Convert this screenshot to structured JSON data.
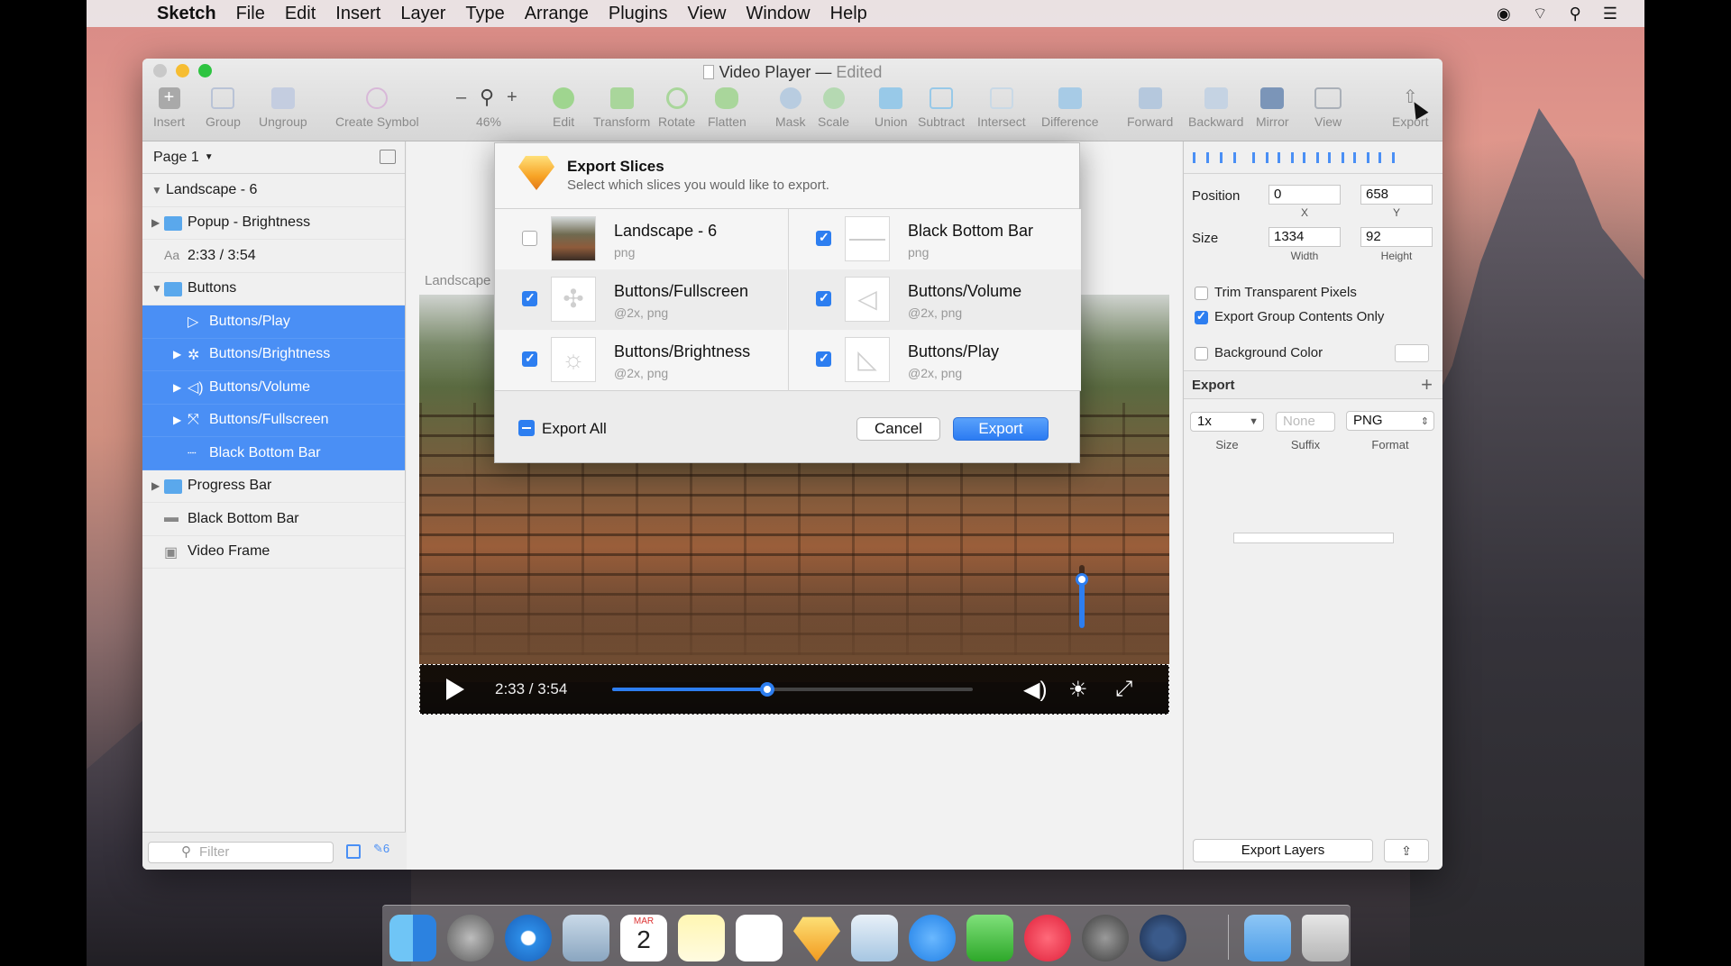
{
  "menubar": {
    "app": "Sketch",
    "items": [
      "File",
      "Edit",
      "Insert",
      "Layer",
      "Type",
      "Arrange",
      "Plugins",
      "View",
      "Window",
      "Help"
    ]
  },
  "window": {
    "title": "Video Player",
    "separator": "—",
    "edited": "Edited"
  },
  "toolbar": {
    "insert": "Insert",
    "group": "Group",
    "ungroup": "Ungroup",
    "create_symbol": "Create Symbol",
    "zoom_minus": "–",
    "zoom_plus": "+",
    "zoom": "46%",
    "edit": "Edit",
    "transform": "Transform",
    "rotate": "Rotate",
    "flatten": "Flatten",
    "mask": "Mask",
    "scale": "Scale",
    "union": "Union",
    "subtract": "Subtract",
    "intersect": "Intersect",
    "difference": "Difference",
    "forward": "Forward",
    "backward": "Backward",
    "mirror": "Mirror",
    "view": "View",
    "export": "Export"
  },
  "layers": {
    "page": "Page 1",
    "items": [
      {
        "name": "Landscape - 6",
        "indent": 0,
        "tri": "▼",
        "icon": "none",
        "selected": false
      },
      {
        "name": "Popup - Brightness",
        "indent": 1,
        "tri": "▶",
        "icon": "folder",
        "selected": false
      },
      {
        "name": "2:33 / 3:54",
        "indent": 1,
        "tri": "",
        "icon": "text",
        "selected": false,
        "icon_text": "Aa"
      },
      {
        "name": "Buttons",
        "indent": 1,
        "tri": "▼",
        "icon": "folder",
        "selected": false
      },
      {
        "name": "Buttons/Play",
        "indent": 2,
        "tri": "",
        "icon": "play",
        "selected": true
      },
      {
        "name": "Buttons/Brightness",
        "indent": 2,
        "tri": "▶",
        "icon": "brightness",
        "selected": true
      },
      {
        "name": "Buttons/Volume",
        "indent": 2,
        "tri": "▶",
        "icon": "volume",
        "selected": true
      },
      {
        "name": "Buttons/Fullscreen",
        "indent": 2,
        "tri": "▶",
        "icon": "fullscreen",
        "selected": true
      },
      {
        "name": "Black Bottom Bar",
        "indent": 2,
        "tri": "",
        "icon": "slice",
        "selected": true
      },
      {
        "name": "Progress Bar",
        "indent": 1,
        "tri": "▶",
        "icon": "folder",
        "selected": false
      },
      {
        "name": "Black Bottom Bar",
        "indent": 1,
        "tri": "",
        "icon": "rect",
        "selected": false
      },
      {
        "name": "Video Frame",
        "indent": 1,
        "tri": "",
        "icon": "image",
        "selected": false
      }
    ],
    "filter_placeholder": "Filter",
    "slice_count": "6"
  },
  "canvas": {
    "artboard_label": "Landscape",
    "player_time": "2:33 / 3:54",
    "progress": 0.43,
    "volume": 0.8
  },
  "dialog": {
    "title": "Export Slices",
    "subtitle": "Select which slices you would like to export.",
    "slices": [
      {
        "name": "Landscape - 6",
        "format": "png",
        "checked": false,
        "thumb": "photo"
      },
      {
        "name": "Black Bottom Bar",
        "format": "png",
        "checked": true,
        "thumb": "bar"
      },
      {
        "name": "Buttons/Fullscreen",
        "format": "@2x, png",
        "checked": true,
        "thumb": "fullscreen"
      },
      {
        "name": "Buttons/Volume",
        "format": "@2x, png",
        "checked": true,
        "thumb": "volume"
      },
      {
        "name": "Buttons/Brightness",
        "format": "@2x, png",
        "checked": true,
        "thumb": "brightness"
      },
      {
        "name": "Buttons/Play",
        "format": "@2x, png",
        "checked": true,
        "thumb": "play"
      }
    ],
    "export_all": "Export All",
    "cancel": "Cancel",
    "export": "Export"
  },
  "inspector": {
    "position_label": "Position",
    "x": "0",
    "y": "658",
    "x_label": "X",
    "y_label": "Y",
    "size_label": "Size",
    "width": "1334",
    "height": "92",
    "width_label": "Width",
    "height_label": "Height",
    "trim": "Trim Transparent Pixels",
    "trim_checked": false,
    "group_only": "Export Group Contents Only",
    "group_only_checked": true,
    "bg_color": "Background Color",
    "bg_checked": false,
    "export_title": "Export",
    "add": "+",
    "export_size": "1x",
    "suffix_placeholder": "None",
    "format": "PNG",
    "size_label2": "Size",
    "suffix_label": "Suffix",
    "format_label": "Format",
    "export_layers": "Export Layers"
  },
  "dock": {
    "calendar_month": "MAR",
    "calendar_day": "2"
  },
  "colors": {
    "accent": "#2d7ef0",
    "selection": "#4a8ff5"
  }
}
